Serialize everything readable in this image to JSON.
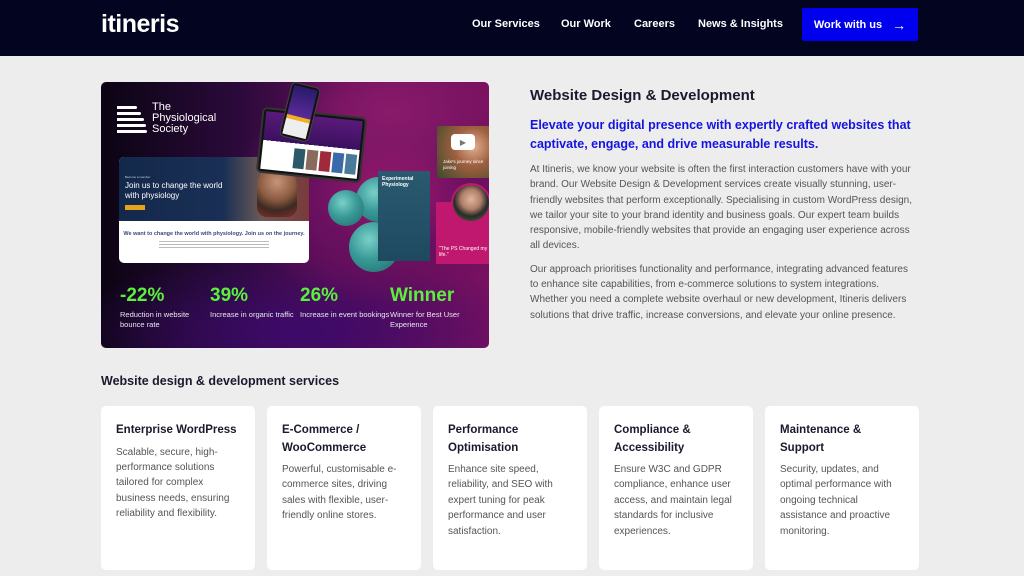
{
  "header": {
    "logo": "itineris",
    "nav": [
      {
        "label": "Our Services"
      },
      {
        "label": "Our Work"
      },
      {
        "label": "Careers"
      },
      {
        "label": "News & Insights"
      }
    ],
    "cta_label": "Work with us",
    "cta_icon": "arrow-right-icon",
    "cta_color": "#0000ee",
    "background_color": "#020420"
  },
  "hero": {
    "client_logo": "The Physiological Society",
    "client_logo_lines": [
      "The",
      "Physiological",
      "Society"
    ],
    "site_screenshot": {
      "eyebrow": "Become a member",
      "headline": "Join us to change the world with physiology",
      "subheadline": "We want to change the world with physiology. Join us on the journey."
    },
    "journal_card": "Experimental Physiology",
    "video_card_caption": "Jake's journey since joining",
    "quote_card": "\"The PS Changed my life.\"",
    "stats": [
      {
        "value": "-22%",
        "description": "Reduction in website bounce rate"
      },
      {
        "value": "39%",
        "description": "Increase in organic traffic"
      },
      {
        "value": "26%",
        "description": "Increase in event bookings"
      },
      {
        "value": "Winner",
        "description": "Winner for Best User Experience"
      }
    ],
    "stat_color": "#5af03c"
  },
  "content": {
    "title": "Website Design & Development",
    "lead": "Elevate your digital presence with expertly crafted websites that captivate, engage, and drive measurable results.",
    "paragraphs": [
      "At Itineris, we know your website is often the first interaction customers have with your brand. Our Website Design & Development services create visually stunning, user-friendly websites that perform exceptionally. Specialising in custom WordPress design, we tailor your site to your brand identity and business goals. Our expert team builds responsive, mobile-friendly websites that provide an engaging user experience across all devices.",
      "Our approach prioritises functionality and performance, integrating advanced features to enhance site capabilities, from e-commerce solutions to system integrations. Whether you need a complete website overhaul or new development, Itineris delivers solutions that drive traffic, increase conversions, and elevate your online presence."
    ],
    "lead_color": "#1414e0"
  },
  "services": {
    "title": "Website design & development services",
    "cards": [
      {
        "title": "Enterprise WordPress",
        "description": "Scalable, secure, high-performance solutions tailored for complex business needs, ensuring reliability and flexibility."
      },
      {
        "title": "E-Commerce / WooCommerce",
        "description": "Powerful, customisable e-commerce sites, driving sales with flexible, user-friendly online stores."
      },
      {
        "title": "Performance Optimisation",
        "description": "Enhance site speed, reliability, and SEO with expert tuning for peak performance and user satisfaction."
      },
      {
        "title": "Compliance & Accessibility",
        "description": "Ensure W3C and GDPR compliance, enhance user access, and maintain legal standards for inclusive experiences."
      },
      {
        "title": "Maintenance & Support",
        "description": "Security, updates, and optimal performance with ongoing technical assistance and proactive monitoring."
      }
    ]
  }
}
